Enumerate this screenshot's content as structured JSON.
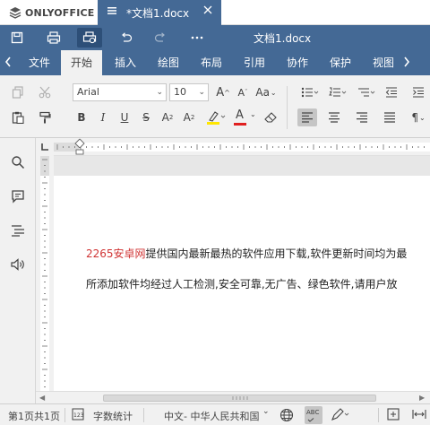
{
  "app": {
    "logo_text": "ONLYOFFICE"
  },
  "doc_tab": {
    "label": "*文档1.docx"
  },
  "header": {
    "title": "文档1.docx"
  },
  "ribbon_tabs": [
    {
      "label": "文件"
    },
    {
      "label": "开始"
    },
    {
      "label": "插入"
    },
    {
      "label": "绘图"
    },
    {
      "label": "布局"
    },
    {
      "label": "引用"
    },
    {
      "label": "协作"
    },
    {
      "label": "保护"
    },
    {
      "label": "视图"
    }
  ],
  "toolbar": {
    "font_name": "Arial",
    "font_size": "10",
    "grow_font": "A",
    "shrink_font": "A",
    "change_case": "Aa",
    "bold": "B",
    "italic": "I",
    "underline": "U",
    "strikethrough": "S",
    "superscript": "A",
    "subscript": "A",
    "font_color_letter": "A",
    "paragraph_mark": "¶"
  },
  "document": {
    "line1_brand": "2265安卓网",
    "line1_rest": "提供国内最新最热的软件应用下载,软件更新时间均为最",
    "line2": "所添加软件均经过人工检测,安全可靠,无广告、绿色软件,请用户放"
  },
  "status": {
    "page_info": "第1页共1页",
    "word_count": "字数统计",
    "language": "中文- 中华人民共和国",
    "spell_label": "ABC"
  },
  "colors": {
    "brand_blue": "#446995",
    "highlight_yellow": "#ffe600",
    "font_color_red": "#e02020",
    "brand_red": "#d03434"
  }
}
